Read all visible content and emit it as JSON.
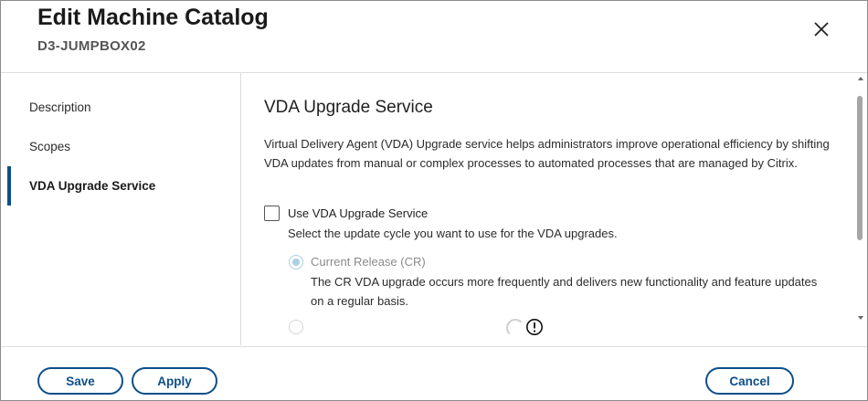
{
  "dialog": {
    "title": "Edit Machine Catalog",
    "subtitle": "D3-JUMPBOX02"
  },
  "sidebar": {
    "items": [
      {
        "label": "Description",
        "active": false
      },
      {
        "label": "Scopes",
        "active": false
      },
      {
        "label": "VDA Upgrade Service",
        "active": true
      }
    ]
  },
  "main": {
    "section_title": "VDA Upgrade Service",
    "description": "Virtual Delivery Agent (VDA) Upgrade service helps administrators improve operational efficiency by shifting VDA updates from manual or complex processes to automated processes that are managed by Citrix.",
    "use_service": {
      "label": "Use VDA Upgrade Service",
      "checked": false
    },
    "cycle_hint": "Select the update cycle you want to use for the VDA upgrades.",
    "options": [
      {
        "label": "Current Release (CR)",
        "selected": true,
        "disabled": true,
        "description": "The CR VDA upgrade occurs more frequently and delivers new functionality and feature updates on a regular basis."
      }
    ],
    "icons": {
      "warning": "exclamation-circle-icon",
      "loading": "spinner-icon"
    }
  },
  "footer": {
    "save_label": "Save",
    "apply_label": "Apply",
    "cancel_label": "Cancel"
  },
  "colors": {
    "accent": "#0b4f8a",
    "radio_disabled": "#a9cfe3"
  }
}
